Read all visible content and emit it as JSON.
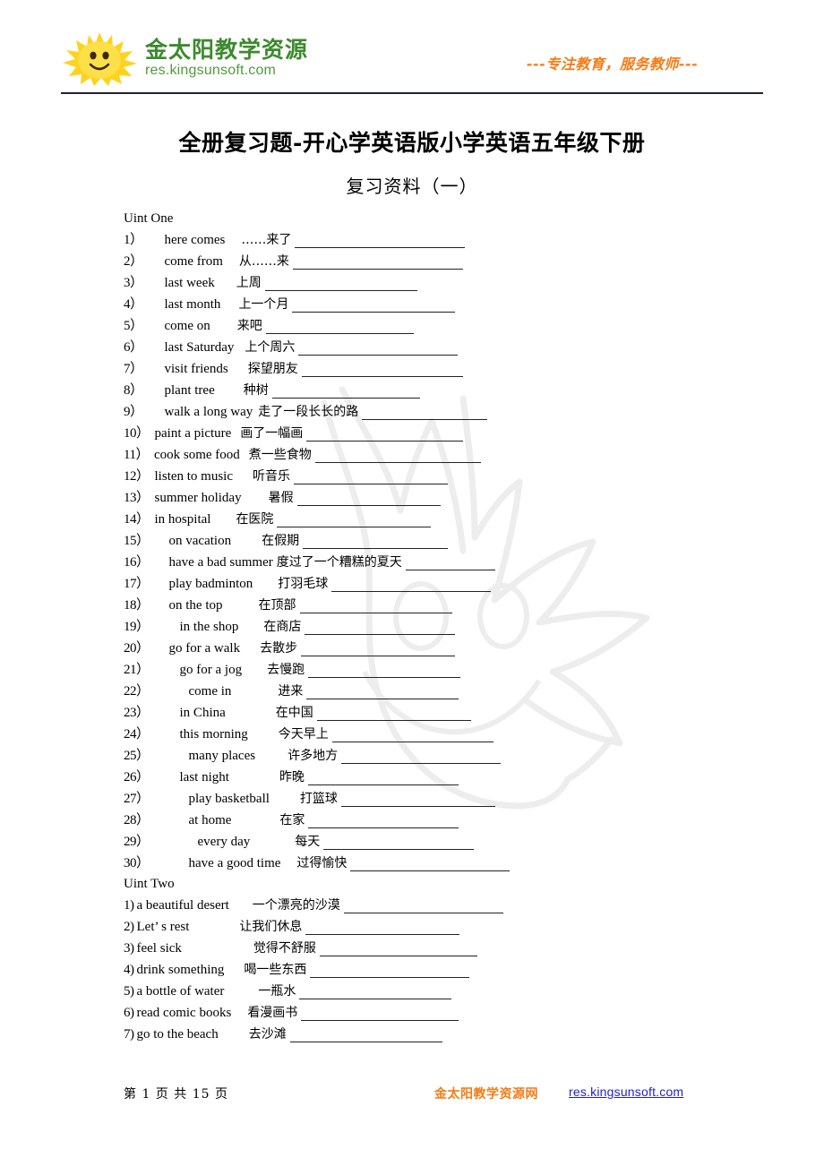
{
  "header": {
    "logo_name": "sun-smiley-logo",
    "brand_cn": "金太阳教学资源",
    "brand_url": "res.kingsunsoft.com",
    "slogan": "---专注教育，服务教师---"
  },
  "title": "全册复习题-开心学英语版小学英语五年级下册",
  "subtitle": "复习资料（一）",
  "units": [
    {
      "heading": "Uint One",
      "items": [
        {
          "num": "1）",
          "en": "here comes",
          "cn": "……来了",
          "num_pad": 0,
          "en_pad": 24,
          "cn_pad": 18,
          "blank": 190
        },
        {
          "num": "2）",
          "en": "come from",
          "cn": "从……来",
          "num_pad": 0,
          "en_pad": 24,
          "cn_pad": 18,
          "blank": 190
        },
        {
          "num": "3）",
          "en": "last week",
          "cn": "上周",
          "num_pad": 0,
          "en_pad": 24,
          "cn_pad": 24,
          "blank": 170
        },
        {
          "num": "4）",
          "en": "last month",
          "cn": "上一个月",
          "num_pad": 0,
          "en_pad": 24,
          "cn_pad": 20,
          "blank": 182
        },
        {
          "num": "5）",
          "en": "come on",
          "cn": "来吧",
          "num_pad": 0,
          "en_pad": 24,
          "cn_pad": 30,
          "blank": 165
        },
        {
          "num": "6）",
          "en": "last Saturday",
          "cn": "上个周六",
          "num_pad": 0,
          "en_pad": 24,
          "cn_pad": 12,
          "blank": 178
        },
        {
          "num": "7）",
          "en": "visit friends",
          "cn": "探望朋友",
          "num_pad": 0,
          "en_pad": 24,
          "cn_pad": 22,
          "blank": 180
        },
        {
          "num": "8）",
          "en": "plant tree",
          "cn": "种树",
          "num_pad": 0,
          "en_pad": 24,
          "cn_pad": 32,
          "blank": 165
        },
        {
          "num": "9）",
          "en": "walk a long way",
          "cn": "走了一段长长的路",
          "num_pad": 0,
          "en_pad": 24,
          "cn_pad": 6,
          "blank": 140
        },
        {
          "num": "10）",
          "en": "paint a picture",
          "cn": "画了一幅画",
          "num_pad": 0,
          "en_pad": 6,
          "cn_pad": 10,
          "blank": 175
        },
        {
          "num": "11）",
          "en": "cook some food",
          "cn": "煮一些食物",
          "num_pad": 0,
          "en_pad": 6,
          "cn_pad": 10,
          "blank": 185
        },
        {
          "num": "12）",
          "en": "listen to music",
          "cn": "听音乐",
          "num_pad": 0,
          "en_pad": 6,
          "cn_pad": 22,
          "blank": 172
        },
        {
          "num": "13）",
          "en": "summer holiday",
          "cn": "暑假",
          "num_pad": 0,
          "en_pad": 6,
          "cn_pad": 30,
          "blank": 160
        },
        {
          "num": "14）",
          "en": "in hospital",
          "cn": "在医院",
          "num_pad": 0,
          "en_pad": 6,
          "cn_pad": 28,
          "blank": 172
        },
        {
          "num": "15）",
          "en": "on vacation",
          "cn": "在假期",
          "num_pad": 0,
          "en_pad": 22,
          "cn_pad": 34,
          "blank": 162
        },
        {
          "num": "16）",
          "en": "have a bad summer",
          "cn": "度过了一个糟糕的夏天",
          "num_pad": 0,
          "en_pad": 22,
          "cn_pad": 4,
          "blank": 100
        },
        {
          "num": "17）",
          "en": "play badminton",
          "cn": "打羽毛球",
          "num_pad": 0,
          "en_pad": 22,
          "cn_pad": 28,
          "blank": 178
        },
        {
          "num": "18）",
          "en": "on the top",
          "cn": "在顶部",
          "num_pad": 0,
          "en_pad": 22,
          "cn_pad": 40,
          "blank": 170
        },
        {
          "num": "19）",
          "en": "in the shop",
          "cn": "在商店",
          "num_pad": 0,
          "en_pad": 34,
          "cn_pad": 28,
          "blank": 168
        },
        {
          "num": "20）",
          "en": "go for a walk",
          "cn": "去散步",
          "num_pad": 0,
          "en_pad": 22,
          "cn_pad": 22,
          "blank": 172
        },
        {
          "num": "21）",
          "en": "go for a jog",
          "cn": "去慢跑",
          "num_pad": 0,
          "en_pad": 34,
          "cn_pad": 28,
          "blank": 170
        },
        {
          "num": "22）",
          "en": "come in",
          "cn": "进来",
          "num_pad": 0,
          "en_pad": 44,
          "cn_pad": 52,
          "blank": 170
        },
        {
          "num": "23）",
          "en": "in China",
          "cn": "在中国",
          "num_pad": 0,
          "en_pad": 34,
          "cn_pad": 56,
          "blank": 172
        },
        {
          "num": "24）",
          "en": "this morning",
          "cn": "今天早上",
          "num_pad": 0,
          "en_pad": 34,
          "cn_pad": 34,
          "blank": 180
        },
        {
          "num": "25）",
          "en": "many places",
          "cn": "许多地方",
          "num_pad": 0,
          "en_pad": 44,
          "cn_pad": 36,
          "blank": 178
        },
        {
          "num": "26）",
          "en": "last night",
          "cn": "昨晚",
          "num_pad": 0,
          "en_pad": 34,
          "cn_pad": 56,
          "blank": 168
        },
        {
          "num": "27）",
          "en": "play basketball",
          "cn": "打篮球",
          "num_pad": 0,
          "en_pad": 44,
          "cn_pad": 34,
          "blank": 172
        },
        {
          "num": "28）",
          "en": "at home",
          "cn": "在家",
          "num_pad": 0,
          "en_pad": 44,
          "cn_pad": 54,
          "blank": 168
        },
        {
          "num": "29）",
          "en": "every day",
          "cn": "每天",
          "num_pad": 0,
          "en_pad": 54,
          "cn_pad": 50,
          "blank": 168
        },
        {
          "num": "30）",
          "en": "have a good time",
          "cn": "过得愉快",
          "num_pad": 0,
          "en_pad": 44,
          "cn_pad": 18,
          "blank": 178
        }
      ]
    },
    {
      "heading": "Uint Two",
      "items": [
        {
          "num": "1)",
          "en": "a beautiful desert",
          "cn": "一个漂亮的沙漠",
          "num_pad": 0,
          "en_pad": 3,
          "cn_pad": 26,
          "blank": 178
        },
        {
          "num": "2)",
          "en": "Let’ s rest",
          "cn": "让我们休息",
          "num_pad": 0,
          "en_pad": 3,
          "cn_pad": 56,
          "blank": 172
        },
        {
          "num": "3)",
          "en": "feel sick",
          "cn": "觉得不舒服",
          "num_pad": 0,
          "en_pad": 3,
          "cn_pad": 80,
          "blank": 176
        },
        {
          "num": "4)",
          "en": "drink something",
          "cn": "喝一些东西",
          "num_pad": 0,
          "en_pad": 3,
          "cn_pad": 22,
          "blank": 178
        },
        {
          "num": "5)",
          "en": "a bottle of water",
          "cn": "一瓶水",
          "num_pad": 0,
          "en_pad": 3,
          "cn_pad": 38,
          "blank": 170
        },
        {
          "num": "6)",
          "en": "read comic books",
          "cn": "看漫画书",
          "num_pad": 0,
          "en_pad": 3,
          "cn_pad": 18,
          "blank": 176
        },
        {
          "num": "7)",
          "en": "go to the beach",
          "cn": "去沙滩",
          "num_pad": 0,
          "en_pad": 3,
          "cn_pad": 34,
          "blank": 170
        }
      ]
    }
  ],
  "footer": {
    "page_info": "第 1 页 共 15 页",
    "brand": "金太阳教学资源网",
    "link": "res.kingsunsoft.com"
  }
}
